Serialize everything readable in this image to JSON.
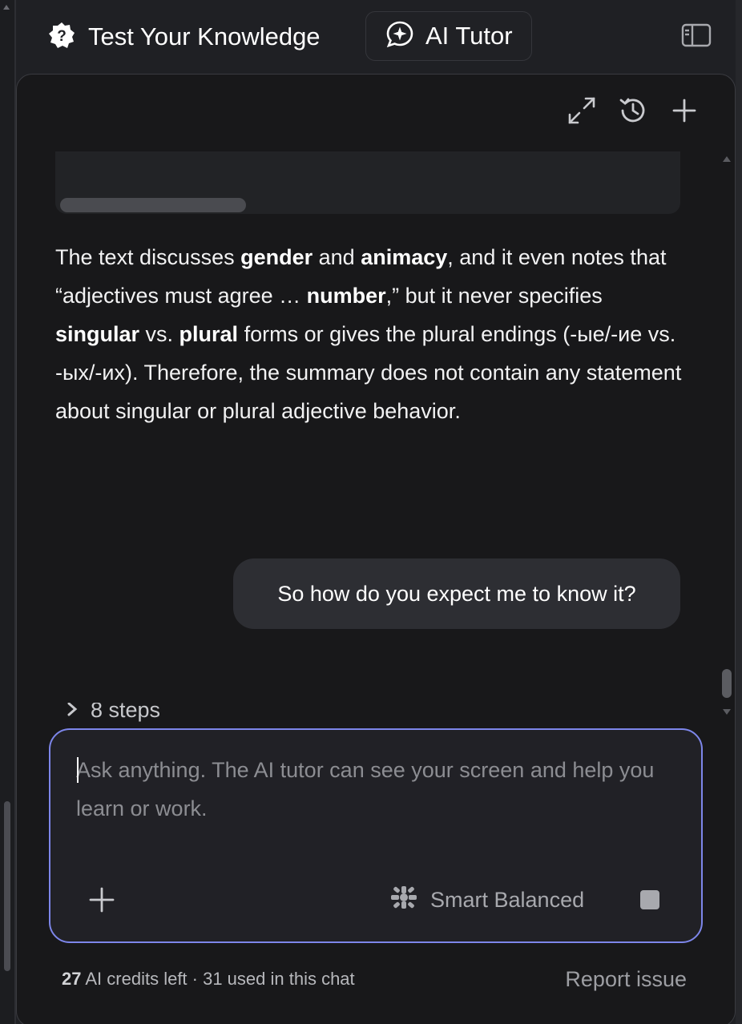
{
  "header": {
    "tab_knowledge_label": "Test Your Knowledge",
    "tab_tutor_label": "AI Tutor"
  },
  "chat": {
    "assistant_message": {
      "p1": "The text discusses ",
      "b1": "gender",
      "p2": " and ",
      "b2": "animacy",
      "p3": ", and it even notes that “adjectives must agree … ",
      "b3": "number",
      "p4": ",” but it never specifies ",
      "b4": "singular",
      "p5": " vs. ",
      "b5": "plural",
      "p6": " forms or gives the plural endings (-ые/-ие vs. -ых/-их). Therefore, the summary does not contain any statement about singular or plural adjective behavior."
    },
    "user_message": "So how do you expect me to know it?",
    "steps_label": "8 steps"
  },
  "composer": {
    "placeholder": "Ask anything. The AI tutor can see your screen and help you learn or work.",
    "value": "",
    "model_label": "Smart Balanced"
  },
  "footer": {
    "credits_count": "27",
    "credits_text": " AI credits left · 31 used in this chat",
    "report_label": "Report issue"
  },
  "colors": {
    "accent_border": "#7d86ea",
    "panel_bg": "#18181a",
    "bubble_bg": "#2d2e33"
  },
  "icons": [
    "help-badge-icon",
    "sparkle-chat-icon",
    "sidebar-toggle-icon",
    "expand-icon",
    "history-icon",
    "plus-icon",
    "chevron-right-icon",
    "model-icon",
    "stop-icon"
  ]
}
